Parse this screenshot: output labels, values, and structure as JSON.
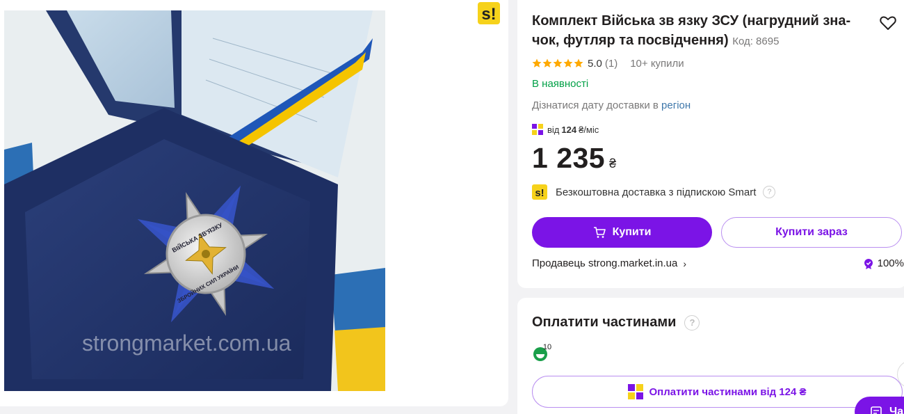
{
  "product": {
    "title": "Комплект Військa зв язку ЗСУ (нагрудний знак, футляр та посвідчення)",
    "title_line1": "Комплект Військa зв язку ЗСУ (нагрудний зна-",
    "title_line2": "чок, футляр та посвідчення)",
    "code": "Код: 8695",
    "rating": "5.0",
    "reviews": "(1)",
    "bought": "10+ купили",
    "stock": "В наявності",
    "delivery_prefix": "Дізнатися дату доставки в",
    "delivery_link": "регіон",
    "installment_prefix": "від",
    "installment_amount": "124",
    "installment_suffix": "₴/міс",
    "price": "1 235",
    "currency": "₴",
    "free_shipping": "Безкоштовна доставка з підпискою Smart",
    "buy_label": "Купити",
    "buy_now_label": "Купити зараз",
    "seller": "Продавець strong.market.in.ua",
    "seller_rating": "100%"
  },
  "photo": {
    "watermark": "strongmarket.com.ua",
    "badge_top": "ВІЙСЬКА ЗВ'ЯЗКУ",
    "badge_bottom": "ЗБРОЙНИХ СИЛ УКРАЇНИ"
  },
  "smart_logo": "s!",
  "parts": {
    "title": "Оплатити частинами",
    "bank_count": "10",
    "button_label": "Оплатити частинами від 124 ₴"
  },
  "chat": {
    "label": "Ча"
  },
  "colors": {
    "accent": "#7b14e6",
    "green": "#00a046",
    "star": "#ffa900",
    "link": "#3e77aa"
  }
}
